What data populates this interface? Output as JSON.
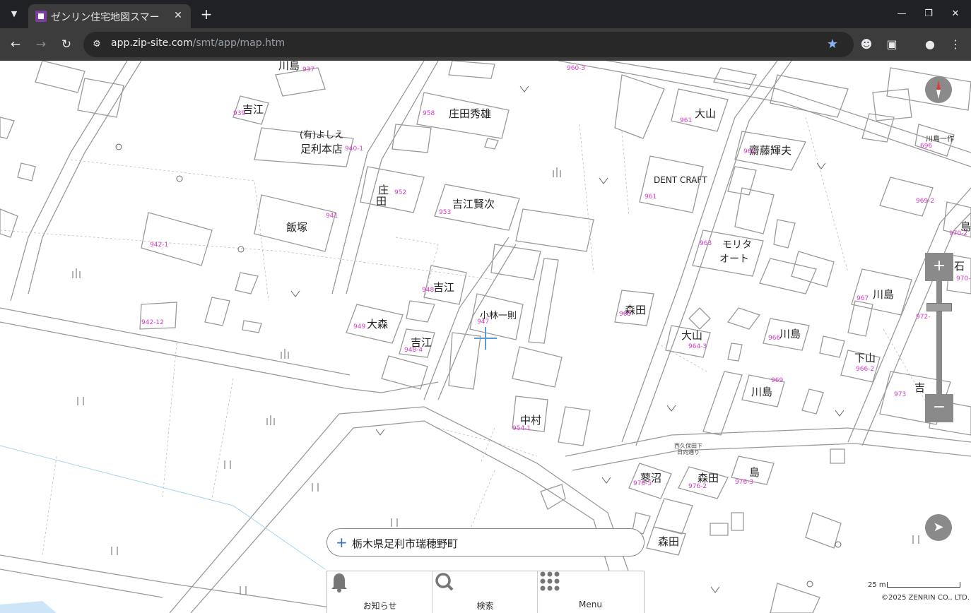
{
  "browser": {
    "tab_title": "ゼンリン住宅地図スマー",
    "url_host": "app.zip-site.com",
    "url_path": "/smt/app/map.htm"
  },
  "icons": {
    "tab_list": "chevron-down-icon",
    "favicon": "zenrin-favicon",
    "close": "close-icon",
    "new_tab": "plus-icon",
    "back": "arrow-left-icon",
    "forward": "arrow-right-icon",
    "reload": "reload-icon",
    "site_info": "tune-icon",
    "bookmark": "star-icon",
    "incognito": "spy-icon",
    "extensions": "puzzle-icon",
    "profile": "account-icon",
    "kebab": "more-vert-icon",
    "compass": "compass-icon",
    "zoom_in": "plus-icon",
    "zoom_out": "minus-icon",
    "locate": "navigation-arrow-icon",
    "notice": "bell-icon",
    "search": "magnifier-icon",
    "menu": "grid-dots-icon"
  },
  "map": {
    "labels": [
      {
        "text": "川島"
      },
      {
        "text": "吉江"
      },
      {
        "text": "庄田秀雄"
      },
      {
        "text": "大山"
      },
      {
        "text": "(有)よしえ"
      },
      {
        "text": "足利本店"
      },
      {
        "text": "齋藤輝夫"
      },
      {
        "text": "川島一作"
      },
      {
        "text": "吉江賢次"
      },
      {
        "text": "DENT CRAFT"
      },
      {
        "text": "飯塚"
      },
      {
        "text": "モリタ"
      },
      {
        "text": "オート"
      },
      {
        "text": "吉江"
      },
      {
        "text": "小林一則"
      },
      {
        "text": "森田"
      },
      {
        "text": "川島"
      },
      {
        "text": "大森"
      },
      {
        "text": "吉江"
      },
      {
        "text": "大山"
      },
      {
        "text": "川島"
      },
      {
        "text": "下山"
      },
      {
        "text": "川島"
      },
      {
        "text": "中村"
      },
      {
        "text": "蓼沼"
      },
      {
        "text": "森田"
      },
      {
        "text": "島"
      },
      {
        "text": "森田"
      },
      {
        "text": "庄"
      },
      {
        "text": "田"
      },
      {
        "text": "吉"
      },
      {
        "text": "石"
      },
      {
        "text": "島"
      }
    ],
    "numbers": [
      "937",
      "939",
      "958",
      "960-3",
      "961",
      "940-1",
      "962",
      "696",
      "952",
      "953",
      "961",
      "941",
      "963",
      "969-2",
      "942-1",
      "970-2",
      "970-",
      "948",
      "965",
      "967",
      "942-12",
      "947",
      "949",
      "948-4",
      "964-3",
      "966",
      "972-",
      "966-2",
      "969",
      "973",
      "954-1",
      "976-5",
      "976-2",
      "976-3"
    ],
    "street_label": "西久保田下",
    "street_label2": "日向通り"
  },
  "address": {
    "text": "栃木県足利市瑞穂野町"
  },
  "menu": {
    "items": [
      {
        "label": "お知らせ"
      },
      {
        "label": "検索"
      },
      {
        "label": "Menu"
      }
    ]
  },
  "scale": {
    "label": "25 m"
  },
  "copyright": "©2025 ZENRIN CO., LTD."
}
